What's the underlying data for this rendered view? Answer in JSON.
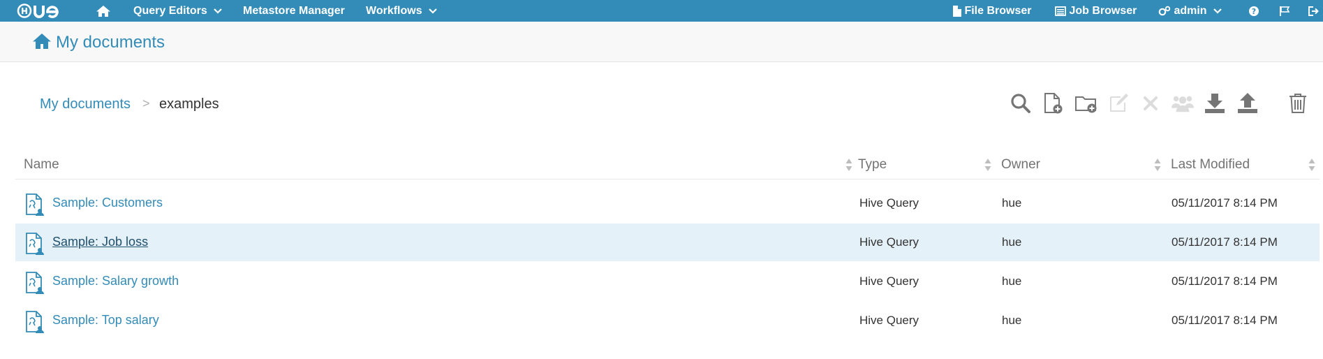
{
  "colors": {
    "brand": "#338bb8",
    "hover_row": "#e5f1f9",
    "icon_active": "#757575",
    "icon_disabled": "#dcdcdc"
  },
  "topnav": {
    "logo_text": "HUE",
    "home_icon": "home-icon",
    "query_editors": "Query Editors",
    "metastore_manager": "Metastore Manager",
    "workflows": "Workflows",
    "file_browser": "File Browser",
    "job_browser": "Job Browser",
    "user": "admin",
    "help_icon": "question-circle-icon",
    "flag_icon": "flag-icon",
    "logout_icon": "sign-out-icon"
  },
  "page": {
    "title": "My documents"
  },
  "breadcrumb": {
    "root": "My documents",
    "separator": ">",
    "current": "examples"
  },
  "toolbar": [
    {
      "icon": "search-icon",
      "enabled": true
    },
    {
      "icon": "new-document-icon",
      "enabled": true
    },
    {
      "icon": "new-folder-icon",
      "enabled": true
    },
    {
      "icon": "edit-icon",
      "enabled": false
    },
    {
      "icon": "delete-x-icon",
      "enabled": false
    },
    {
      "icon": "share-users-icon",
      "enabled": false
    },
    {
      "icon": "download-icon",
      "enabled": true
    },
    {
      "icon": "upload-icon",
      "enabled": true
    },
    {
      "icon": "trash-icon",
      "enabled": true
    }
  ],
  "table": {
    "columns": [
      "Name",
      "Type",
      "Owner",
      "Last Modified"
    ],
    "rows": [
      {
        "name": "Sample: Customers",
        "type": "Hive Query",
        "owner": "hue",
        "modified": "05/11/2017 8:14 PM",
        "hover": false
      },
      {
        "name": "Sample: Job loss",
        "type": "Hive Query",
        "owner": "hue",
        "modified": "05/11/2017 8:14 PM",
        "hover": true
      },
      {
        "name": "Sample: Salary growth",
        "type": "Hive Query",
        "owner": "hue",
        "modified": "05/11/2017 8:14 PM",
        "hover": false
      },
      {
        "name": "Sample: Top salary",
        "type": "Hive Query",
        "owner": "hue",
        "modified": "05/11/2017 8:14 PM",
        "hover": false
      }
    ]
  }
}
